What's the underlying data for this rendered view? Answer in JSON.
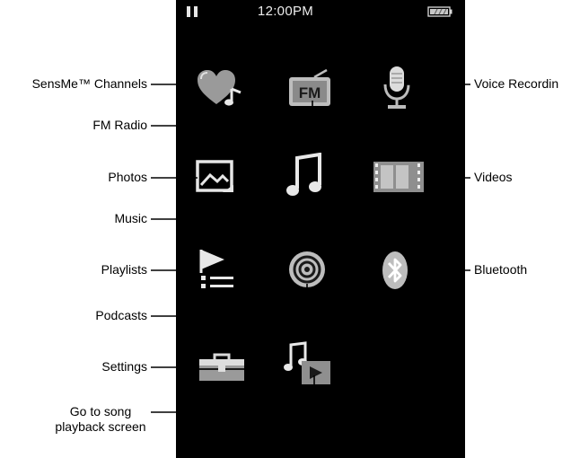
{
  "status_bar": {
    "time": "12:00PM",
    "playback_state_icon": "pause-icon",
    "battery_icon": "battery-icon"
  },
  "home_menu": {
    "items": [
      {
        "label": "SensMe™ Channels",
        "icon": "heart-music-icon"
      },
      {
        "label": "FM Radio",
        "icon": "fm-radio-icon"
      },
      {
        "label": "Voice Recordin",
        "icon": "microphone-icon"
      },
      {
        "label": "Photos",
        "icon": "photo-icon"
      },
      {
        "label": "Music",
        "icon": "music-note-icon"
      },
      {
        "label": "Videos",
        "icon": "film-strip-icon"
      },
      {
        "label": "Playlists",
        "icon": "playlist-icon"
      },
      {
        "label": "Podcasts",
        "icon": "podcast-icon"
      },
      {
        "label": "Bluetooth",
        "icon": "bluetooth-icon"
      },
      {
        "label": "Settings",
        "icon": "toolbox-icon"
      },
      {
        "label": "Go to song playback screen",
        "line1": "Go to song",
        "line2": "playback screen",
        "icon": "now-playing-icon"
      }
    ]
  },
  "colors": {
    "screen": "#000000",
    "icon_light": "#e8e8e8",
    "icon_mid": "#9a9a9a",
    "icon_dark": "#5a5a5a",
    "callout": "#000000"
  }
}
